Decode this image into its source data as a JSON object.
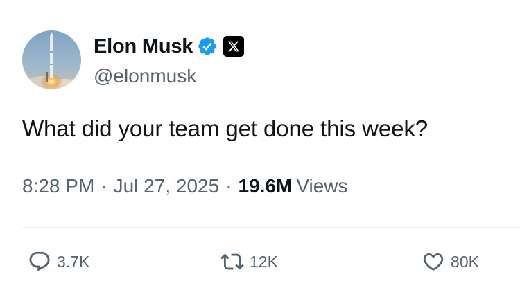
{
  "author": {
    "display_name": "Elon Musk",
    "handle": "@elonmusk",
    "avatar_icon": "rocket-launch-avatar",
    "verified_icon": "verified-badge-icon",
    "affiliate_icon": "x-logo-icon"
  },
  "tweet": {
    "text": "What did your team get done this week?",
    "time": "8:28 PM",
    "date": "Jul 27, 2025",
    "separator": "·",
    "views_count": "19.6M",
    "views_label": "Views"
  },
  "actions": {
    "replies": "3.7K",
    "reposts": "12K",
    "likes": "80K"
  },
  "colors": {
    "primary_text": "#0f1419",
    "secondary_text": "#536471",
    "verified_blue": "#1d9bf0",
    "divider": "#eff3f4"
  }
}
